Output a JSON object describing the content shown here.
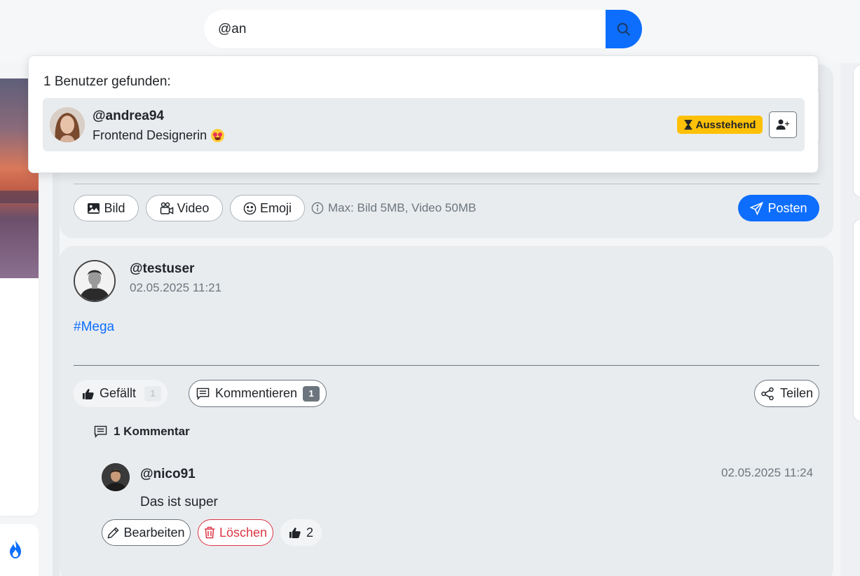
{
  "search": {
    "value": "@an",
    "icon": "search-icon",
    "button_color": "#0d6efd"
  },
  "composer": {
    "buttons": [
      {
        "label": "Bild",
        "icon": "image-icon"
      },
      {
        "label": "Video",
        "icon": "video-icon"
      },
      {
        "label": "Emoji",
        "icon": "smile-icon"
      }
    ],
    "hint": "Max: Bild 5MB, Video 50MB",
    "post_label": "Posten"
  },
  "post": {
    "username": "@testuser",
    "date": "02.05.2025 11:21",
    "text": "#Mega",
    "like_label": "Gefällt",
    "like_count": "1",
    "comment_label": "Kommentieren",
    "comment_count": "1",
    "share_label": "Teilen"
  },
  "comments": {
    "heading": "1 Kommentar",
    "items": [
      {
        "username": "@nico91",
        "date": "02.05.2025 11:24",
        "text": "Das ist super",
        "edit_label": "Bearbeiten",
        "delete_label": "Löschen",
        "like_count": "2"
      }
    ]
  },
  "search_results": {
    "heading": "1 Benutzer gefunden:",
    "users": [
      {
        "username": "@andrea94",
        "bio": "Frontend Designerin",
        "bio_emoji": "😍",
        "status": "Ausstehend",
        "status_color": "#ffc107"
      }
    ]
  },
  "colors": {
    "primary": "#0d6efd",
    "danger": "#dc3545",
    "warning": "#ffc107",
    "card_bg": "#e9ecef"
  }
}
